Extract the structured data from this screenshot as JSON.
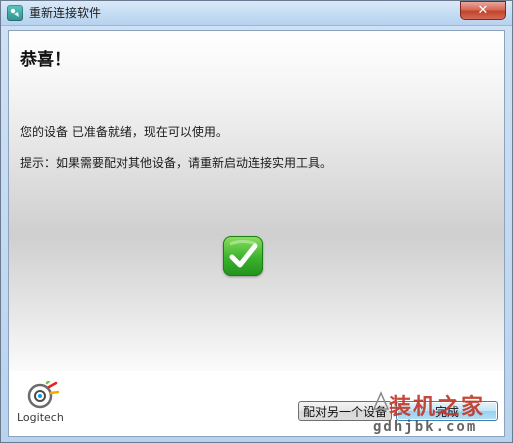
{
  "window": {
    "title": "重新连接软件",
    "close_glyph": "✕"
  },
  "content": {
    "heading": "恭喜！",
    "message_ready": "您的设备  已准备就绪，现在可以使用。",
    "message_tip": "提示：如果需要配对其他设备，请重新启动连接实用工具。",
    "success_icon": "check-icon"
  },
  "footer": {
    "logo_text": "Logitech",
    "pair_button_label": "配对另一个设备",
    "done_button_label": "完成"
  },
  "watermark": {
    "title": "装机之家",
    "url": "gdhjbk.com"
  },
  "colors": {
    "titlebar": "#c4dcf3",
    "close_button": "#c2432b",
    "success_green": "#3bb22c",
    "default_button": "#98d1ef",
    "watermark_red": "#c0392b"
  }
}
